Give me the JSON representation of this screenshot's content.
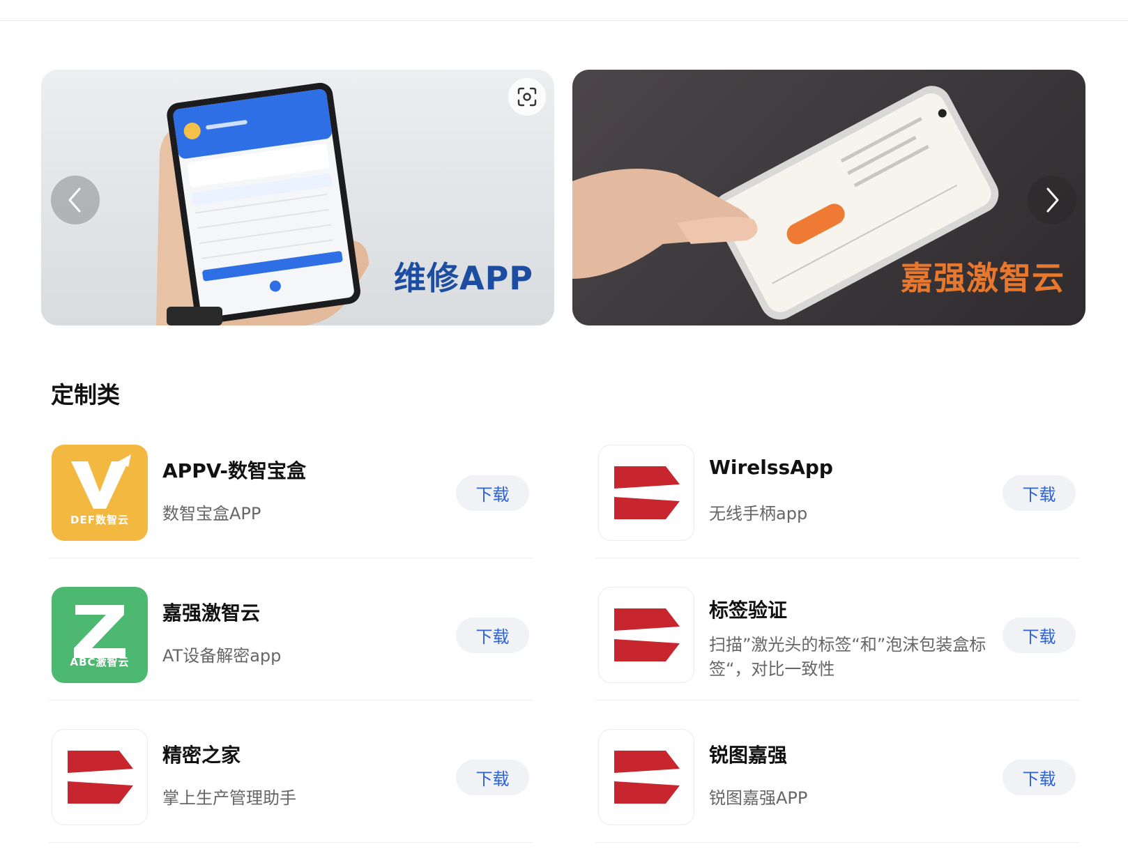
{
  "carousel": {
    "slides": [
      {
        "caption": "维修APP"
      },
      {
        "caption": "嘉强激智云"
      }
    ]
  },
  "section": {
    "title": "定制类"
  },
  "apps": [
    {
      "name": "APPV-数智宝盒",
      "desc": "数智宝盒APP",
      "button": "下载",
      "icon_label": "DEF数智云",
      "icon": "v-logo-icon",
      "icon_color": "#F3B83F"
    },
    {
      "name": "WirelssApp",
      "desc": "无线手柄app",
      "button": "下载",
      "icon": "red-arrow-logo-icon",
      "icon_color": "#C8262E"
    },
    {
      "name": "嘉强激智云",
      "desc": "AT设备解密app",
      "button": "下载",
      "icon_label": "ABC激智云",
      "icon": "z-logo-icon",
      "icon_color": "#4CB870"
    },
    {
      "name": "标签验证",
      "desc": "扫描”激光头的标签“和”泡沫包装盒标签“，对比一致性",
      "button": "下载",
      "icon": "red-arrow-logo-icon",
      "icon_color": "#C8262E"
    },
    {
      "name": "精密之家",
      "desc": "掌上生产管理助手",
      "button": "下载",
      "icon": "red-arrow-logo-icon",
      "icon_color": "#C8262E"
    },
    {
      "name": "锐图嘉强",
      "desc": "锐图嘉强APP",
      "button": "下载",
      "icon": "red-arrow-logo-icon",
      "icon_color": "#C8262E"
    }
  ]
}
